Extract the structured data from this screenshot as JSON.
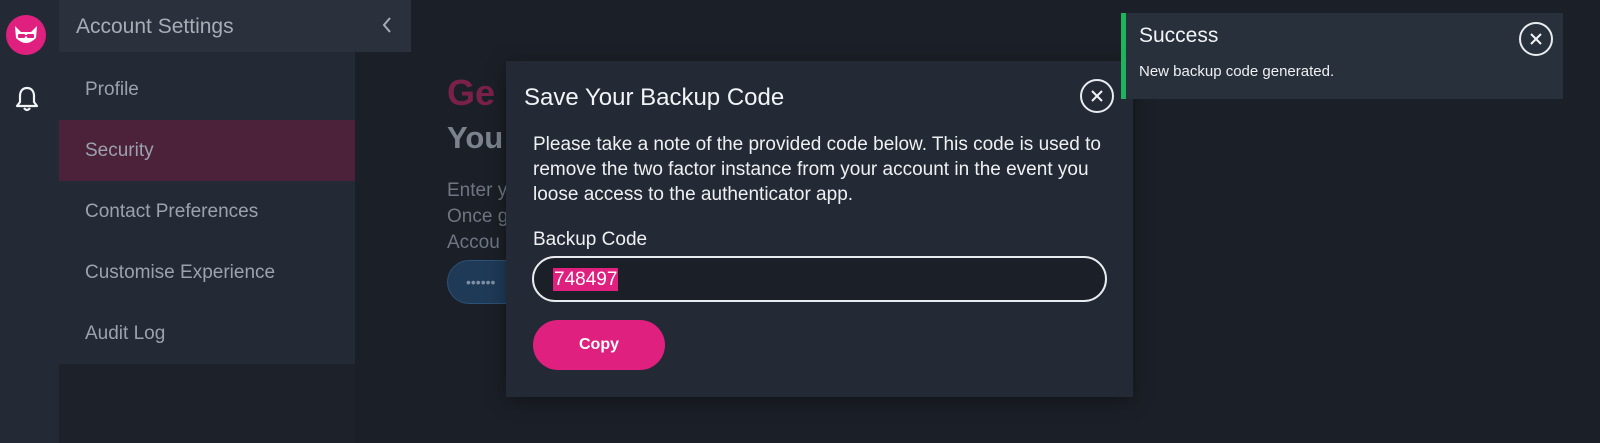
{
  "app": {
    "logo_icon": "fox-mascot-icon",
    "notification_icon": "bell-icon",
    "accent_color": "#e0207f"
  },
  "settings": {
    "title": "Account Settings",
    "collapse_icon": "chevron-left-icon",
    "nav": [
      {
        "label": "Profile",
        "active": false
      },
      {
        "label": "Security",
        "active": true
      },
      {
        "label": "Contact Preferences",
        "active": false
      },
      {
        "label": "Customise Experience",
        "active": false
      },
      {
        "label": "Audit Log",
        "active": false
      }
    ]
  },
  "page": {
    "heading1": "Ge",
    "heading2": "You",
    "text_lines": [
      "Enter y",
      "Once g",
      "Accou"
    ],
    "input_value": "••••••"
  },
  "modal": {
    "title": "Save Your Backup Code",
    "close_icon": "close-icon",
    "description": "Please take a note of the provided code below. This code is used to remove the two factor instance from your account in the event you loose access to the authenticator app.",
    "field_label": "Backup Code",
    "code": "748497",
    "copy_label": "Copy"
  },
  "toast": {
    "title": "Success",
    "message": "New backup code generated.",
    "status_color": "#1eb35c",
    "close_icon": "close-icon"
  }
}
